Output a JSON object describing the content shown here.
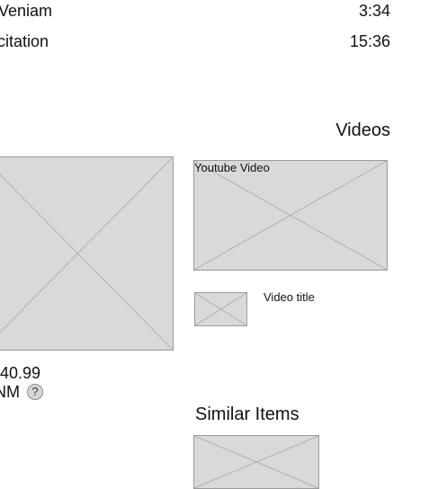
{
  "tracks": [
    {
      "title": " Veniam",
      "duration": "3:34"
    },
    {
      "title": "citation",
      "duration": "15:36"
    }
  ],
  "videos": {
    "heading": "Videos",
    "main_video_label": "Youtube Video",
    "video_title": "Video title"
  },
  "product": {
    "price": "$40.99",
    "condition": "NM",
    "help_icon_glyph": "?"
  },
  "similar_items": {
    "heading": "Similar Items"
  },
  "icons": {
    "placeholder": "image-placeholder-icon",
    "help": "help-icon"
  },
  "colors": {
    "placeholder_fill": "#d9d9d9",
    "placeholder_stroke": "#9a9a9a"
  }
}
